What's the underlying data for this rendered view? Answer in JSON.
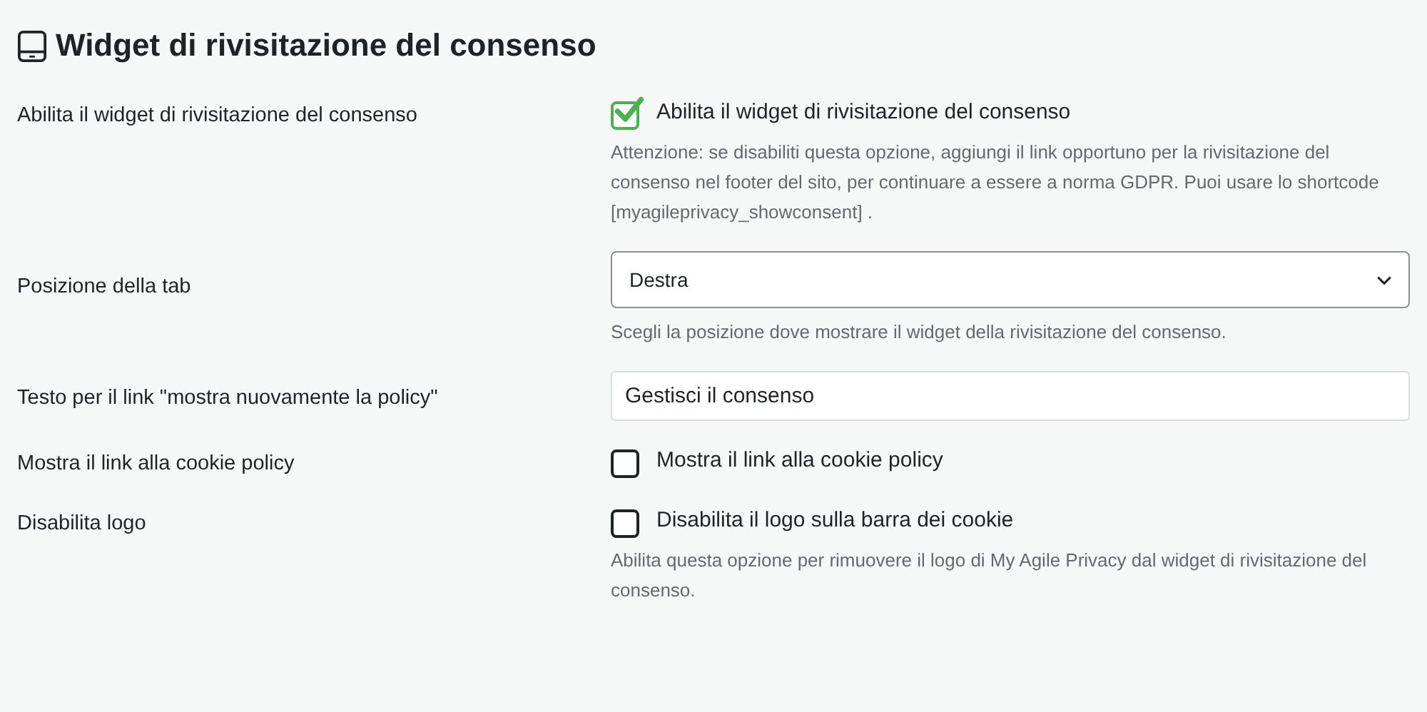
{
  "heading": {
    "title": "Widget di rivisitazione del consenso"
  },
  "rows": [
    {
      "kind": "checkbox",
      "label": "Abilita il widget di rivisitazione del consenso",
      "option": "Abilita il widget di rivisitazione del consenso",
      "checked": true,
      "description": "Attenzione: se disabiliti questa opzione, aggiungi il link opportuno per la rivisitazione del consenso nel footer del sito, per continuare a essere a norma GDPR. Puoi usare lo shortcode [myagileprivacy_showconsent] ."
    },
    {
      "kind": "select",
      "label": "Posizione della tab",
      "value": "Destra",
      "description": "Scegli la posizione dove mostrare il widget della rivisitazione del consenso."
    },
    {
      "kind": "text",
      "label": "Testo per il link \"mostra nuovamente la policy\"",
      "value": "Gestisci il consenso"
    },
    {
      "kind": "checkbox",
      "label": "Mostra il link alla cookie policy",
      "option": "Mostra il link alla cookie policy",
      "checked": false
    },
    {
      "kind": "checkbox",
      "label": "Disabilita logo",
      "option": "Disabilita il logo sulla barra dei cookie",
      "checked": false,
      "description": "Abilita questa opzione per rimuovere il logo di My Agile Privacy dal widget di rivisitazione del consenso."
    }
  ]
}
